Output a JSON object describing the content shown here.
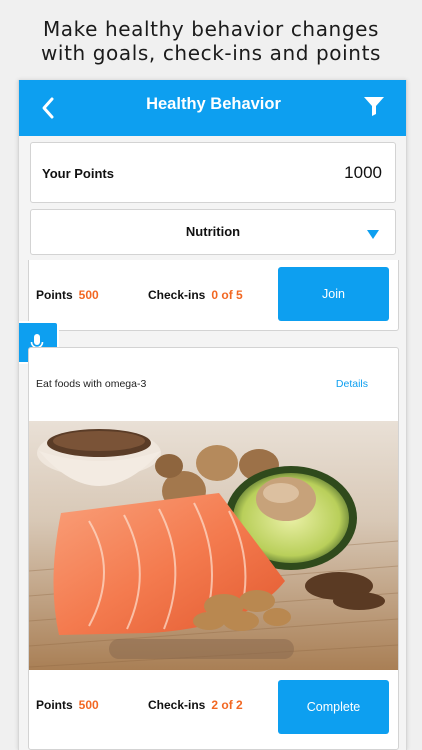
{
  "promo": {
    "line1": "Make healthy behavior changes",
    "line2": "with goals, check-ins and points"
  },
  "header": {
    "title": "Healthy Behavior"
  },
  "points": {
    "label": "Your Points",
    "value": "1000"
  },
  "category": {
    "selected": "Nutrition"
  },
  "goals": [
    {
      "title": "",
      "points_label": "Points",
      "points_value": "500",
      "checkins_label": "Check-ins",
      "checkins_value": "0 of 5",
      "action": "Join"
    },
    {
      "title": "Eat foods with omega-3",
      "details": "Details",
      "image": "salmon-avocado-walnuts-flaxseed-photo",
      "points_label": "Points",
      "points_value": "500",
      "checkins_label": "Check-ins",
      "checkins_value": "2 of 2",
      "action": "Complete"
    }
  ],
  "colors": {
    "brand": "#0d9ff0",
    "accent": "#f26722"
  }
}
